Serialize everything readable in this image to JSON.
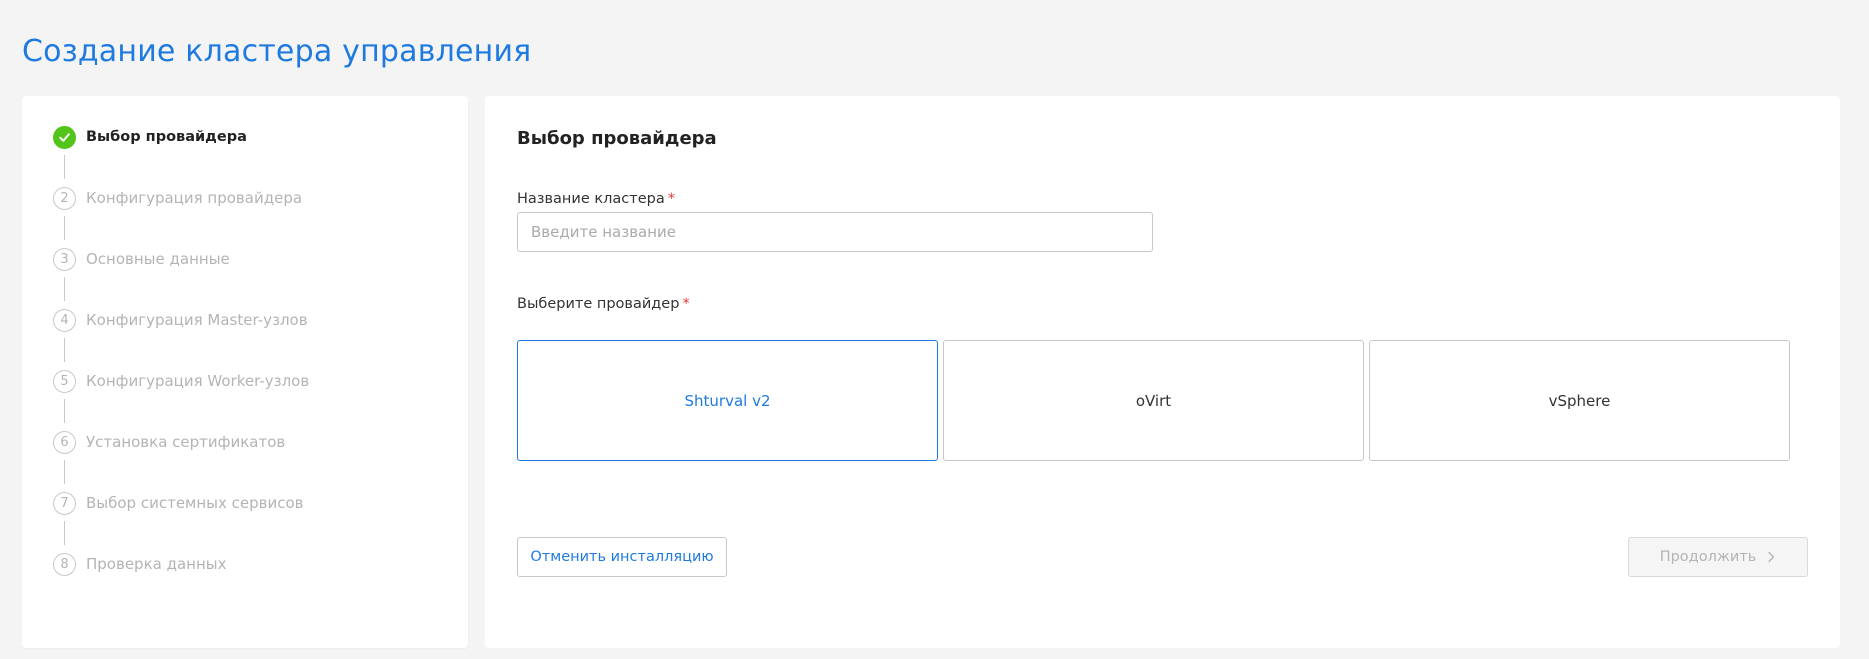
{
  "page_title": "Создание кластера управления",
  "steps": [
    {
      "number": "1",
      "label": "Выбор провайдера",
      "status": "done"
    },
    {
      "number": "2",
      "label": "Конфигурация провайдера",
      "status": "pending"
    },
    {
      "number": "3",
      "label": "Основные данные",
      "status": "pending"
    },
    {
      "number": "4",
      "label": "Конфигурация Master-узлов",
      "status": "pending"
    },
    {
      "number": "5",
      "label": "Конфигурация Worker-узлов",
      "status": "pending"
    },
    {
      "number": "6",
      "label": "Установка сертификатов",
      "status": "pending"
    },
    {
      "number": "7",
      "label": "Выбор системных сервисов",
      "status": "pending"
    },
    {
      "number": "8",
      "label": "Проверка данных",
      "status": "pending"
    }
  ],
  "form": {
    "heading": "Выбор провайдера",
    "cluster_name_label": "Название кластера",
    "cluster_name_placeholder": "Введите название",
    "cluster_name_value": "",
    "required_mark": "*",
    "provider_label": "Выберите провайдер",
    "providers": [
      {
        "label": "Shturval v2",
        "selected": true
      },
      {
        "label": "oVirt",
        "selected": false
      },
      {
        "label": "vSphere",
        "selected": false
      }
    ],
    "cancel_label": "Отменить инсталляцию",
    "continue_label": "Продолжить",
    "continue_icon": "chevron-right-icon"
  },
  "colors": {
    "accent": "#1f7ae0",
    "success": "#52c41a",
    "required": "#e53935",
    "background": "#f4f4f4"
  }
}
